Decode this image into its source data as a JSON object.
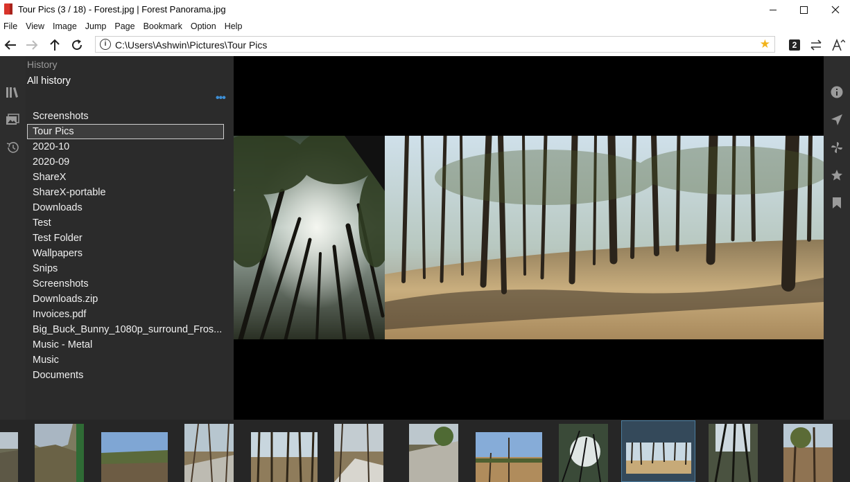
{
  "window": {
    "title": "Tour Pics (3 / 18) - Forest.jpg | Forest Panorama.jpg",
    "controls": {
      "minimize": "minimize",
      "maximize": "maximize",
      "close": "close"
    }
  },
  "menu": {
    "items": [
      "File",
      "View",
      "Image",
      "Jump",
      "Page",
      "Bookmark",
      "Option",
      "Help"
    ]
  },
  "address": {
    "path": "C:\\Users\\Ashwin\\Pictures\\Tour Pics",
    "page_badge": "2"
  },
  "history": {
    "title": "History",
    "all_history": "All history",
    "more": "•••",
    "items": [
      "Screenshots",
      "Tour Pics",
      "2020-10",
      "2020-09",
      "ShareX",
      "ShareX-portable",
      "Downloads",
      "Test",
      "Test Folder",
      "Wallpapers",
      "Snips",
      "Screenshots",
      "Downloads.zip",
      "Invoices.pdf",
      "Big_Buck_Bunny_1080p_surround_Fros...",
      "Music - Metal",
      "Music",
      "Documents"
    ],
    "selected_index": 1
  },
  "colors": {
    "panel_bg": "#2b2b2b",
    "rail_bg": "#2d2d2d",
    "viewer_bg": "#000000",
    "strip_bg": "#262626",
    "selection_accent": "#4b7ea0",
    "star": "#f2b31a",
    "more_dots": "#3d8fd6"
  },
  "thumbnails": {
    "count": 12,
    "selected_index": 9
  }
}
